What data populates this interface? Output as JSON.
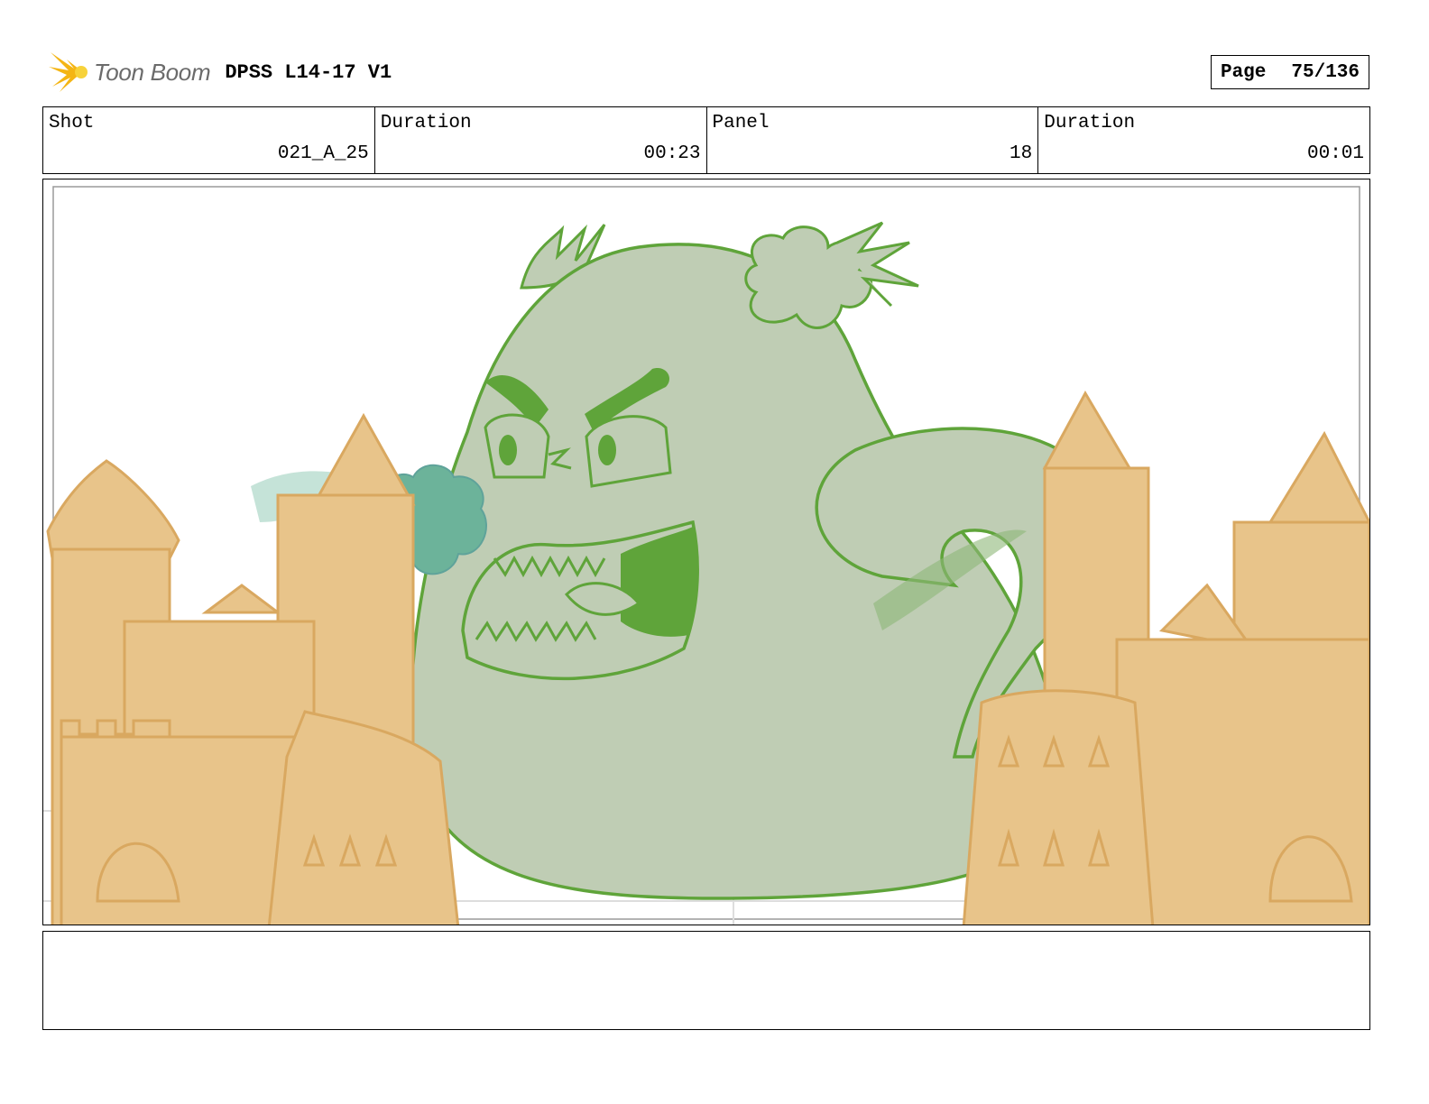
{
  "header": {
    "logo_text": "Toon Boom",
    "project_title": "DPSS L14-17 V1",
    "page_label": "Page",
    "page_value": "75/136"
  },
  "info": {
    "shot_label": "Shot",
    "shot_value": "021_A_25",
    "shot_duration_label": "Duration",
    "shot_duration_value": "00:23",
    "panel_label": "Panel",
    "panel_value": "18",
    "panel_duration_label": "Duration",
    "panel_duration_value": "00:01"
  },
  "colors": {
    "sand": "#e8c48a",
    "sand_line": "#d9a860",
    "ghost_fill": "#bfcdb4",
    "ghost_line": "#5fa43a",
    "mouth_dark": "#5fa43a",
    "puff": "#6cb39a"
  },
  "notes": ""
}
